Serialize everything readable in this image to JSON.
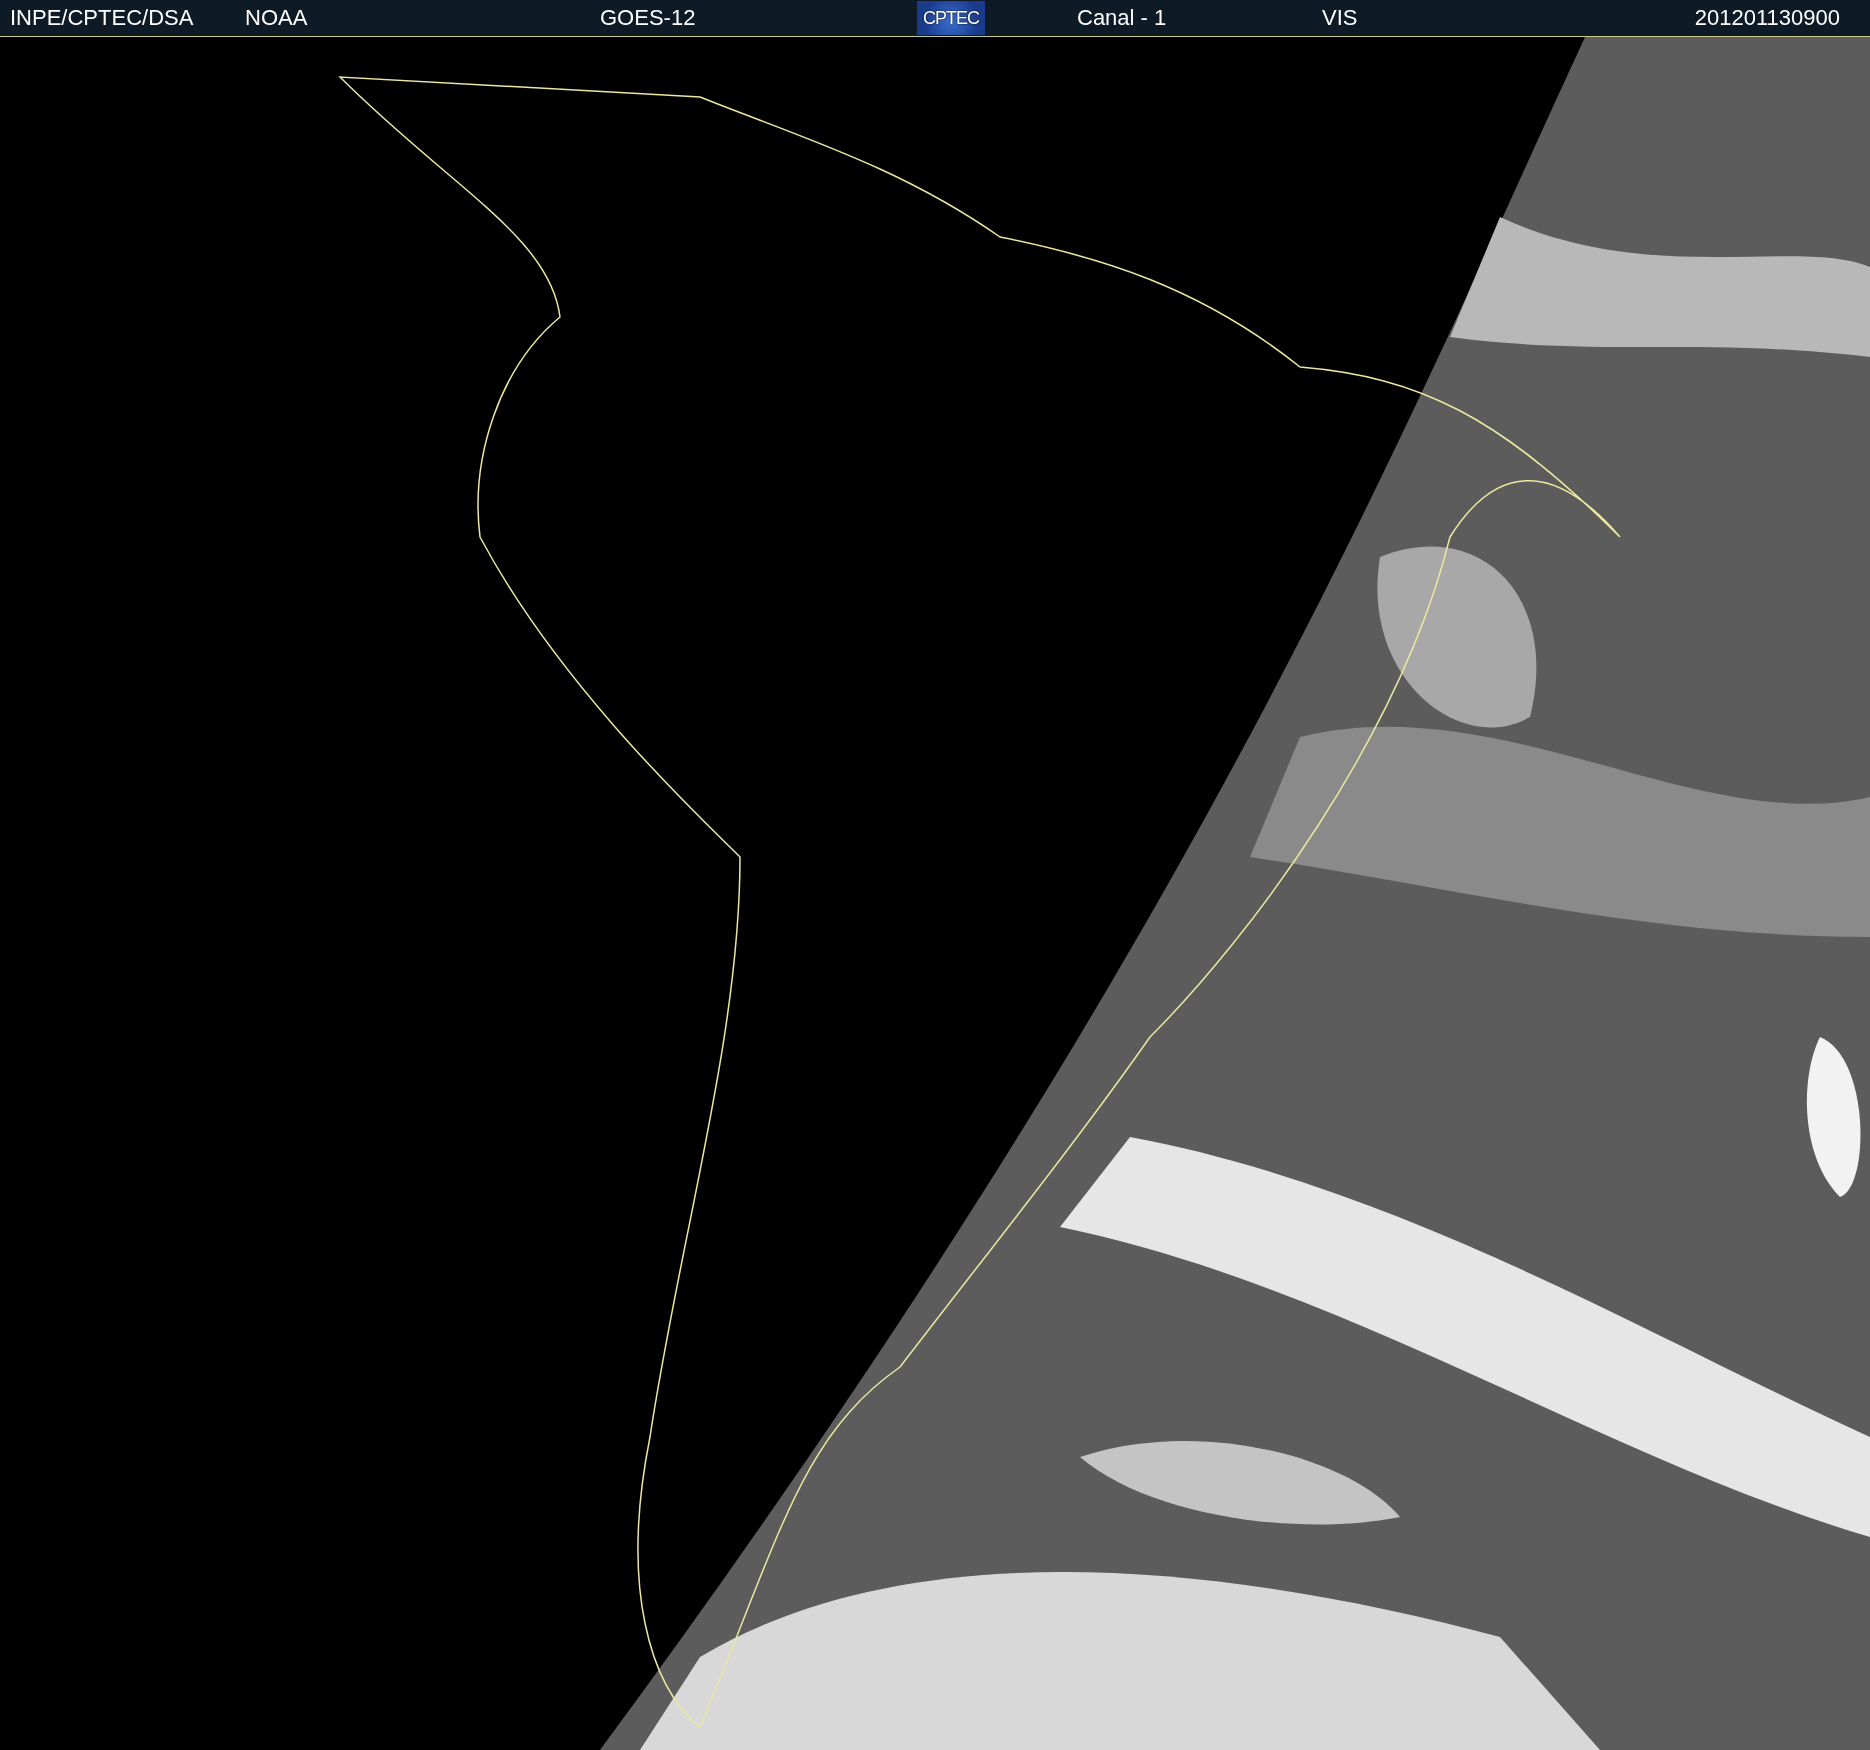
{
  "header": {
    "source": "INPE/CPTEC/DSA",
    "agency": "NOAA",
    "satellite": "GOES-12",
    "logo": "CPTEC",
    "channel": "Canal - 1",
    "band": "VIS",
    "timestamp": "201201130900"
  }
}
